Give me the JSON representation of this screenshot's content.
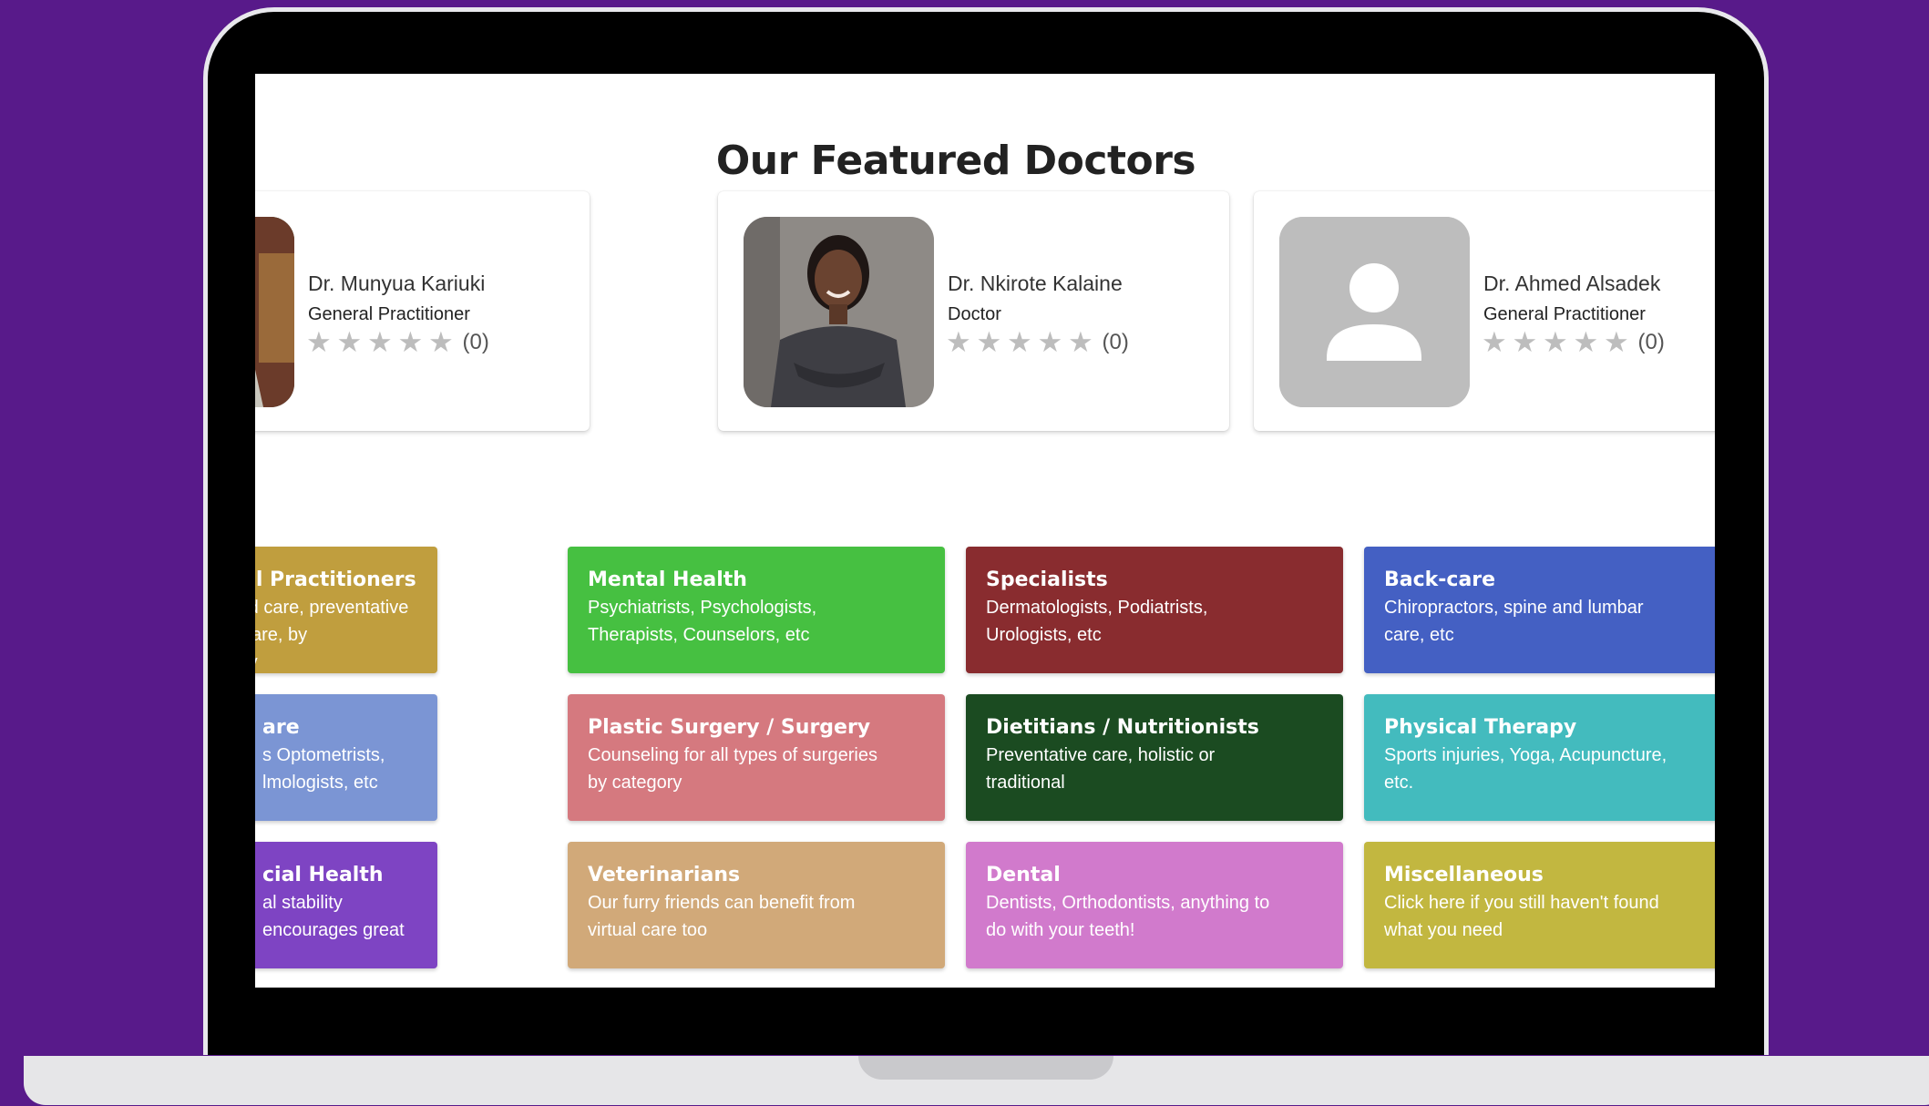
{
  "page": {
    "title": "Our Featured Doctors",
    "background_color": "#581a8a"
  },
  "doctors": [
    {
      "name": "Dr. Munyua Kariuki",
      "title": "General Practitioner",
      "rating_stars": 0,
      "rating_count": "(0)",
      "photo": "man-photo"
    },
    {
      "name": "Dr. Nkirote Kalaine",
      "title": "Doctor",
      "rating_stars": 0,
      "rating_count": "(0)",
      "photo": "woman-photo"
    },
    {
      "name": "Dr. Ahmed Alsadek",
      "title": "General Practitioner",
      "rating_stars": 0,
      "rating_count": "(0)",
      "photo": "placeholder-avatar-icon"
    }
  ],
  "categories": [
    {
      "title": "al Practitioners",
      "description": "rd care, preventative care, by\nry",
      "color": "#c09e3e"
    },
    {
      "title": "Mental Health",
      "description": "Psychiatrists, Psychologists,\nTherapists, Counselors, etc",
      "color": "#46c041"
    },
    {
      "title": "Specialists",
      "description": "Dermatologists, Podiatrists,\nUrologists, etc",
      "color": "#892c2f"
    },
    {
      "title": "Back-care",
      "description": "Chiropractors, spine and lumbar\ncare, etc",
      "color": "#4460c3"
    },
    {
      "title": "are",
      "description": "s Optometrists,\nlmologists, etc",
      "color": "#7b95d4"
    },
    {
      "title": "Plastic Surgery / Surgery",
      "description": "Counseling for all types of surgeries\nby category",
      "color": "#d5797f"
    },
    {
      "title": "Dietitians / Nutritionists",
      "description": "Preventative care, holistic or\ntraditional",
      "color": "#1b4b21"
    },
    {
      "title": "Physical Therapy",
      "description": "Sports injuries, Yoga, Acupuncture,\netc.",
      "color": "#43bbbe"
    },
    {
      "title": "cial Health",
      "description": "al stability encourages great",
      "color": "#7e44c3"
    },
    {
      "title": "Veterinarians",
      "description": "Our furry friends can benefit from\nvirtual care too",
      "color": "#d1a979"
    },
    {
      "title": "Dental",
      "description": "Dentists, Orthodontists, anything to\ndo with your teeth!",
      "color": "#d17acc"
    },
    {
      "title": "Miscellaneous",
      "description": "Click here if you still haven't found\nwhat you need",
      "color": "#c2b740"
    }
  ]
}
